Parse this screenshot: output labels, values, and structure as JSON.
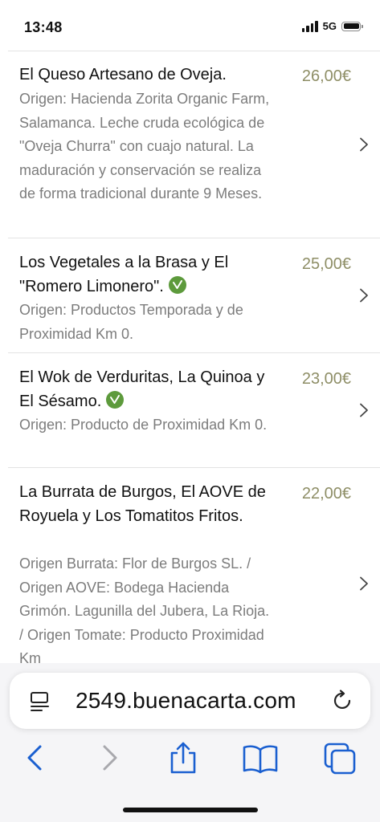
{
  "status": {
    "time": "13:48",
    "network": "5G"
  },
  "menu": {
    "items": [
      {
        "title": "El Queso Artesano de Oveja.",
        "price": "26,00€",
        "vegan": false,
        "description": "Origen: Hacienda Zorita Organic Farm, Salamanca. Leche cruda ecológica de \"Oveja Churra\" con cuajo natural. La maduración y conservación se realiza de forma tradicional durante 9 Meses."
      },
      {
        "title": "Los Vegetales a la Brasa y El \"Romero Limonero\".",
        "price": "25,00€",
        "vegan": true,
        "description": "Origen: Productos Temporada y de Proximidad Km 0."
      },
      {
        "title": "El Wok de Verduritas, La Quinoa y El Sésamo.",
        "price": "23,00€",
        "vegan": true,
        "description": "Origen: Producto de Proximidad Km 0."
      },
      {
        "title": "La Burrata de Burgos, El AOVE de Royuela y Los Tomatitos Fritos.",
        "price": "22,00€",
        "vegan": false,
        "description": "Origen Burrata: Flor de Burgos SL. / Origen AOVE: Bodega Hacienda Grimón. Lagunilla del Jubera, La Rioja. / Origen Tomate: Producto Proximidad Km"
      }
    ]
  },
  "browser": {
    "url": "2549.buenacarta.com",
    "icons": [
      "reader-icon",
      "reload-icon",
      "back-icon",
      "forward-icon",
      "share-icon",
      "bookmarks-icon",
      "tabs-icon"
    ],
    "accent": "#1a5fd0"
  }
}
